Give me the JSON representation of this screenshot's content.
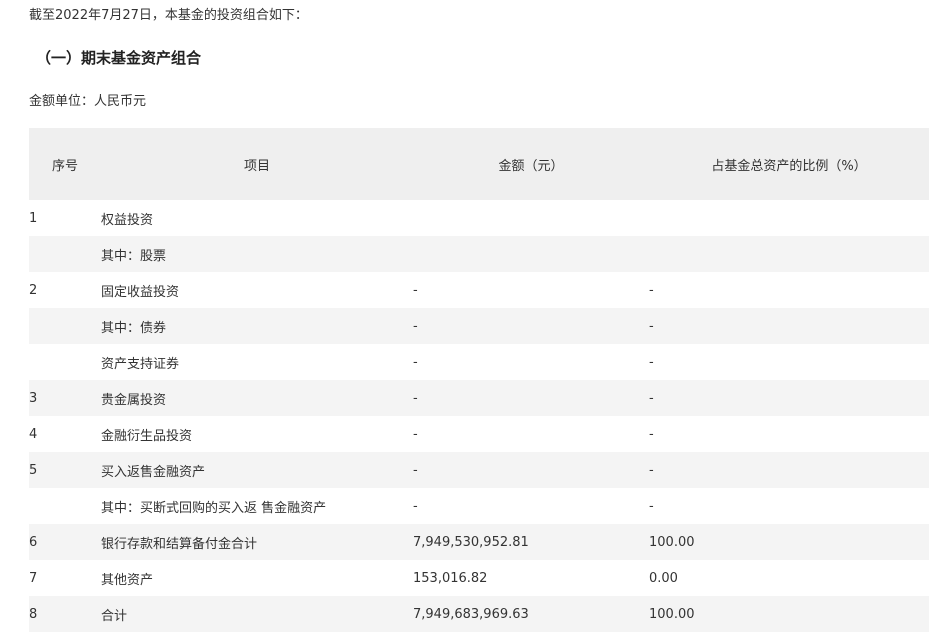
{
  "intro": "截至2022年7月27日，本基金的投资组合如下：",
  "section_title": "（一）期末基金资产组合",
  "unit": "金额单位：人民币元",
  "table": {
    "headers": {
      "no": "序号",
      "item": "项目",
      "amount": "金额（元）",
      "pct": "占基金总资产的比例（%）"
    },
    "rows": [
      {
        "no": "1",
        "item": "权益投资",
        "amount": "",
        "pct": ""
      },
      {
        "no": "",
        "item": "其中：股票",
        "amount": "",
        "pct": ""
      },
      {
        "no": "2",
        "item": "固定收益投资",
        "amount": "-",
        "pct": "-"
      },
      {
        "no": "",
        "item": "其中：债券",
        "amount": "-",
        "pct": "-"
      },
      {
        "no": "",
        "item": "资产支持证券",
        "amount": "-",
        "pct": "-"
      },
      {
        "no": "3",
        "item": "贵金属投资",
        "amount": "-",
        "pct": "-"
      },
      {
        "no": "4",
        "item": "金融衍生品投资",
        "amount": "-",
        "pct": "-"
      },
      {
        "no": "5",
        "item": "买入返售金融资产",
        "amount": "-",
        "pct": "-"
      },
      {
        "no": "",
        "item": "其中：买断式回购的买入返 售金融资产",
        "amount": "-",
        "pct": "-"
      },
      {
        "no": "6",
        "item": "银行存款和结算备付金合计",
        "amount": "7,949,530,952.81",
        "pct": "100.00"
      },
      {
        "no": "7",
        "item": "其他资产",
        "amount": "153,016.82",
        "pct": "0.00"
      },
      {
        "no": "8",
        "item": "合计",
        "amount": "7,949,683,969.63",
        "pct": "100.00"
      }
    ]
  }
}
